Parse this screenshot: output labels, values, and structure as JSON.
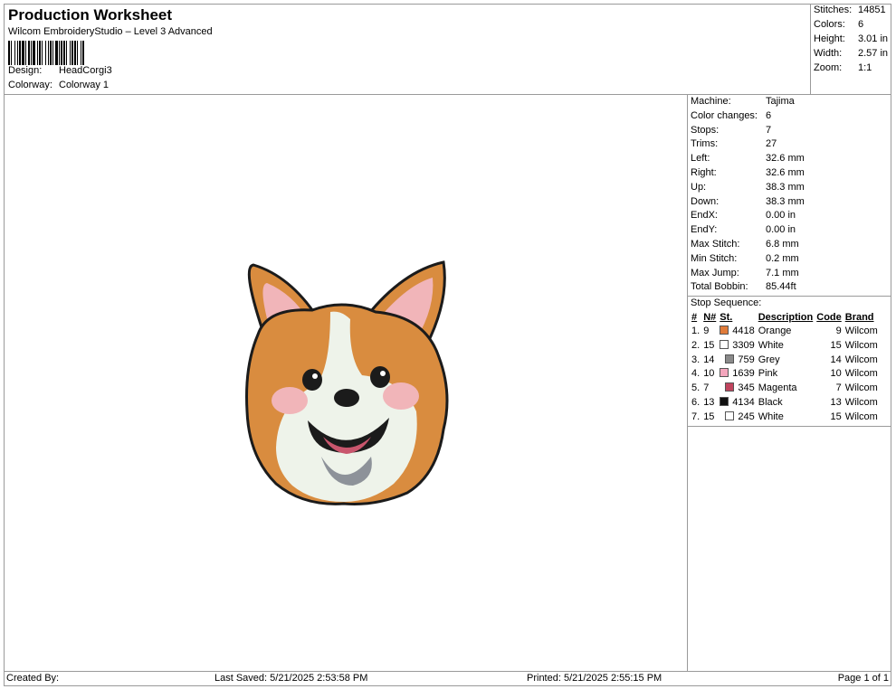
{
  "header": {
    "title": "Production Worksheet",
    "subtitle": "Wilcom EmbroideryStudio – Level 3 Advanced",
    "design_label": "Design:",
    "design_value": "HeadCorgi3",
    "colorway_label": "Colorway:",
    "colorway_value": "Colorway 1"
  },
  "summary": [
    {
      "label": "Stitches:",
      "value": "14851"
    },
    {
      "label": "Colors:",
      "value": "6"
    },
    {
      "label": "Height:",
      "value": "3.01 in"
    },
    {
      "label": "Width:",
      "value": "2.57 in"
    },
    {
      "label": "Zoom:",
      "value": "1:1"
    }
  ],
  "machine_info": [
    {
      "label": "Machine:",
      "value": "Tajima"
    },
    {
      "label": "Color changes:",
      "value": "6"
    },
    {
      "label": "Stops:",
      "value": "7"
    },
    {
      "label": "Trims:",
      "value": "27"
    },
    {
      "label": "Left:",
      "value": "32.6 mm"
    },
    {
      "label": "Right:",
      "value": "32.6 mm"
    },
    {
      "label": "Up:",
      "value": "38.3 mm"
    },
    {
      "label": "Down:",
      "value": "38.3 mm"
    },
    {
      "label": "EndX:",
      "value": "0.00 in"
    },
    {
      "label": "EndY:",
      "value": "0.00 in"
    },
    {
      "label": "Max Stitch:",
      "value": "6.8 mm"
    },
    {
      "label": "Min Stitch:",
      "value": "0.2 mm"
    },
    {
      "label": "Max Jump:",
      "value": "7.1 mm"
    },
    {
      "label": "Total Bobbin:",
      "value": "85.44ft"
    }
  ],
  "stop_sequence": {
    "title": "Stop Sequence:",
    "headers": {
      "num": "#",
      "n": "N#",
      "st": "St.",
      "desc": "Description",
      "code": "Code",
      "brand": "Brand"
    },
    "rows": [
      {
        "num": "1.",
        "n": "9",
        "color": "#e07b3a",
        "st": "4418",
        "desc": "Orange",
        "code": "9",
        "brand": "Wilcom"
      },
      {
        "num": "2.",
        "n": "15",
        "color": "#ffffff",
        "st": "3309",
        "desc": "White",
        "code": "15",
        "brand": "Wilcom"
      },
      {
        "num": "3.",
        "n": "14",
        "color": "#8a8a8a",
        "st": "759",
        "desc": "Grey",
        "code": "14",
        "brand": "Wilcom"
      },
      {
        "num": "4.",
        "n": "10",
        "color": "#f4a6bd",
        "st": "1639",
        "desc": "Pink",
        "code": "10",
        "brand": "Wilcom"
      },
      {
        "num": "5.",
        "n": "7",
        "color": "#c0445e",
        "st": "345",
        "desc": "Magenta",
        "code": "7",
        "brand": "Wilcom"
      },
      {
        "num": "6.",
        "n": "13",
        "color": "#111111",
        "st": "4134",
        "desc": "Black",
        "code": "13",
        "brand": "Wilcom"
      },
      {
        "num": "7.",
        "n": "15",
        "color": "#ffffff",
        "st": "245",
        "desc": "White",
        "code": "15",
        "brand": "Wilcom"
      }
    ]
  },
  "footer": {
    "created_by": "Created By:",
    "last_saved": "Last Saved: 5/21/2025 2:53:58 PM",
    "printed": "Printed: 5/21/2025 2:55:15 PM",
    "page": "Page 1 of 1"
  },
  "design_colors": {
    "orange": "#d98c3f",
    "cream": "#eef3ea",
    "pink": "#f1b5b9",
    "grey": "#8d9299",
    "black": "#1b1b1b",
    "magenta": "#c9566d"
  }
}
